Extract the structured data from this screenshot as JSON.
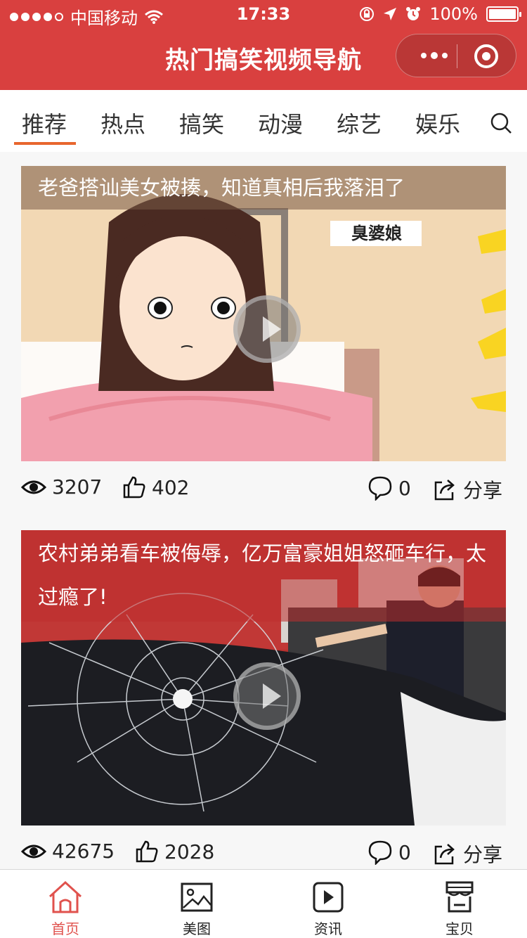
{
  "status_bar": {
    "carrier": "中国移动",
    "time": "17:33",
    "battery": "100%"
  },
  "nav": {
    "title": "热门搞笑视频导航"
  },
  "tabs": [
    {
      "label": "推荐"
    },
    {
      "label": "热点"
    },
    {
      "label": "搞笑"
    },
    {
      "label": "动漫"
    },
    {
      "label": "综艺"
    },
    {
      "label": "娱乐"
    }
  ],
  "videos": [
    {
      "title": "老爸搭讪美女被揍，知道真相后我落泪了",
      "thumb_text": "臭婆娘",
      "views": "3207",
      "likes": "402",
      "comments": "0",
      "share": "分享"
    },
    {
      "title": "农村弟弟看车被侮辱，亿万富豪姐姐怒砸车行，太过瘾了!",
      "views": "42675",
      "likes": "2028",
      "comments": "0",
      "share": "分享"
    }
  ],
  "tabbar": [
    {
      "label": "首页",
      "icon": "home-icon"
    },
    {
      "label": "美图",
      "icon": "image-icon"
    },
    {
      "label": "资讯",
      "icon": "play-icon"
    },
    {
      "label": "宝贝",
      "icon": "store-icon"
    }
  ],
  "colors": {
    "brand": "#d9403f",
    "tab_underline": "#e8662e",
    "active_tab": "#e0524d"
  }
}
